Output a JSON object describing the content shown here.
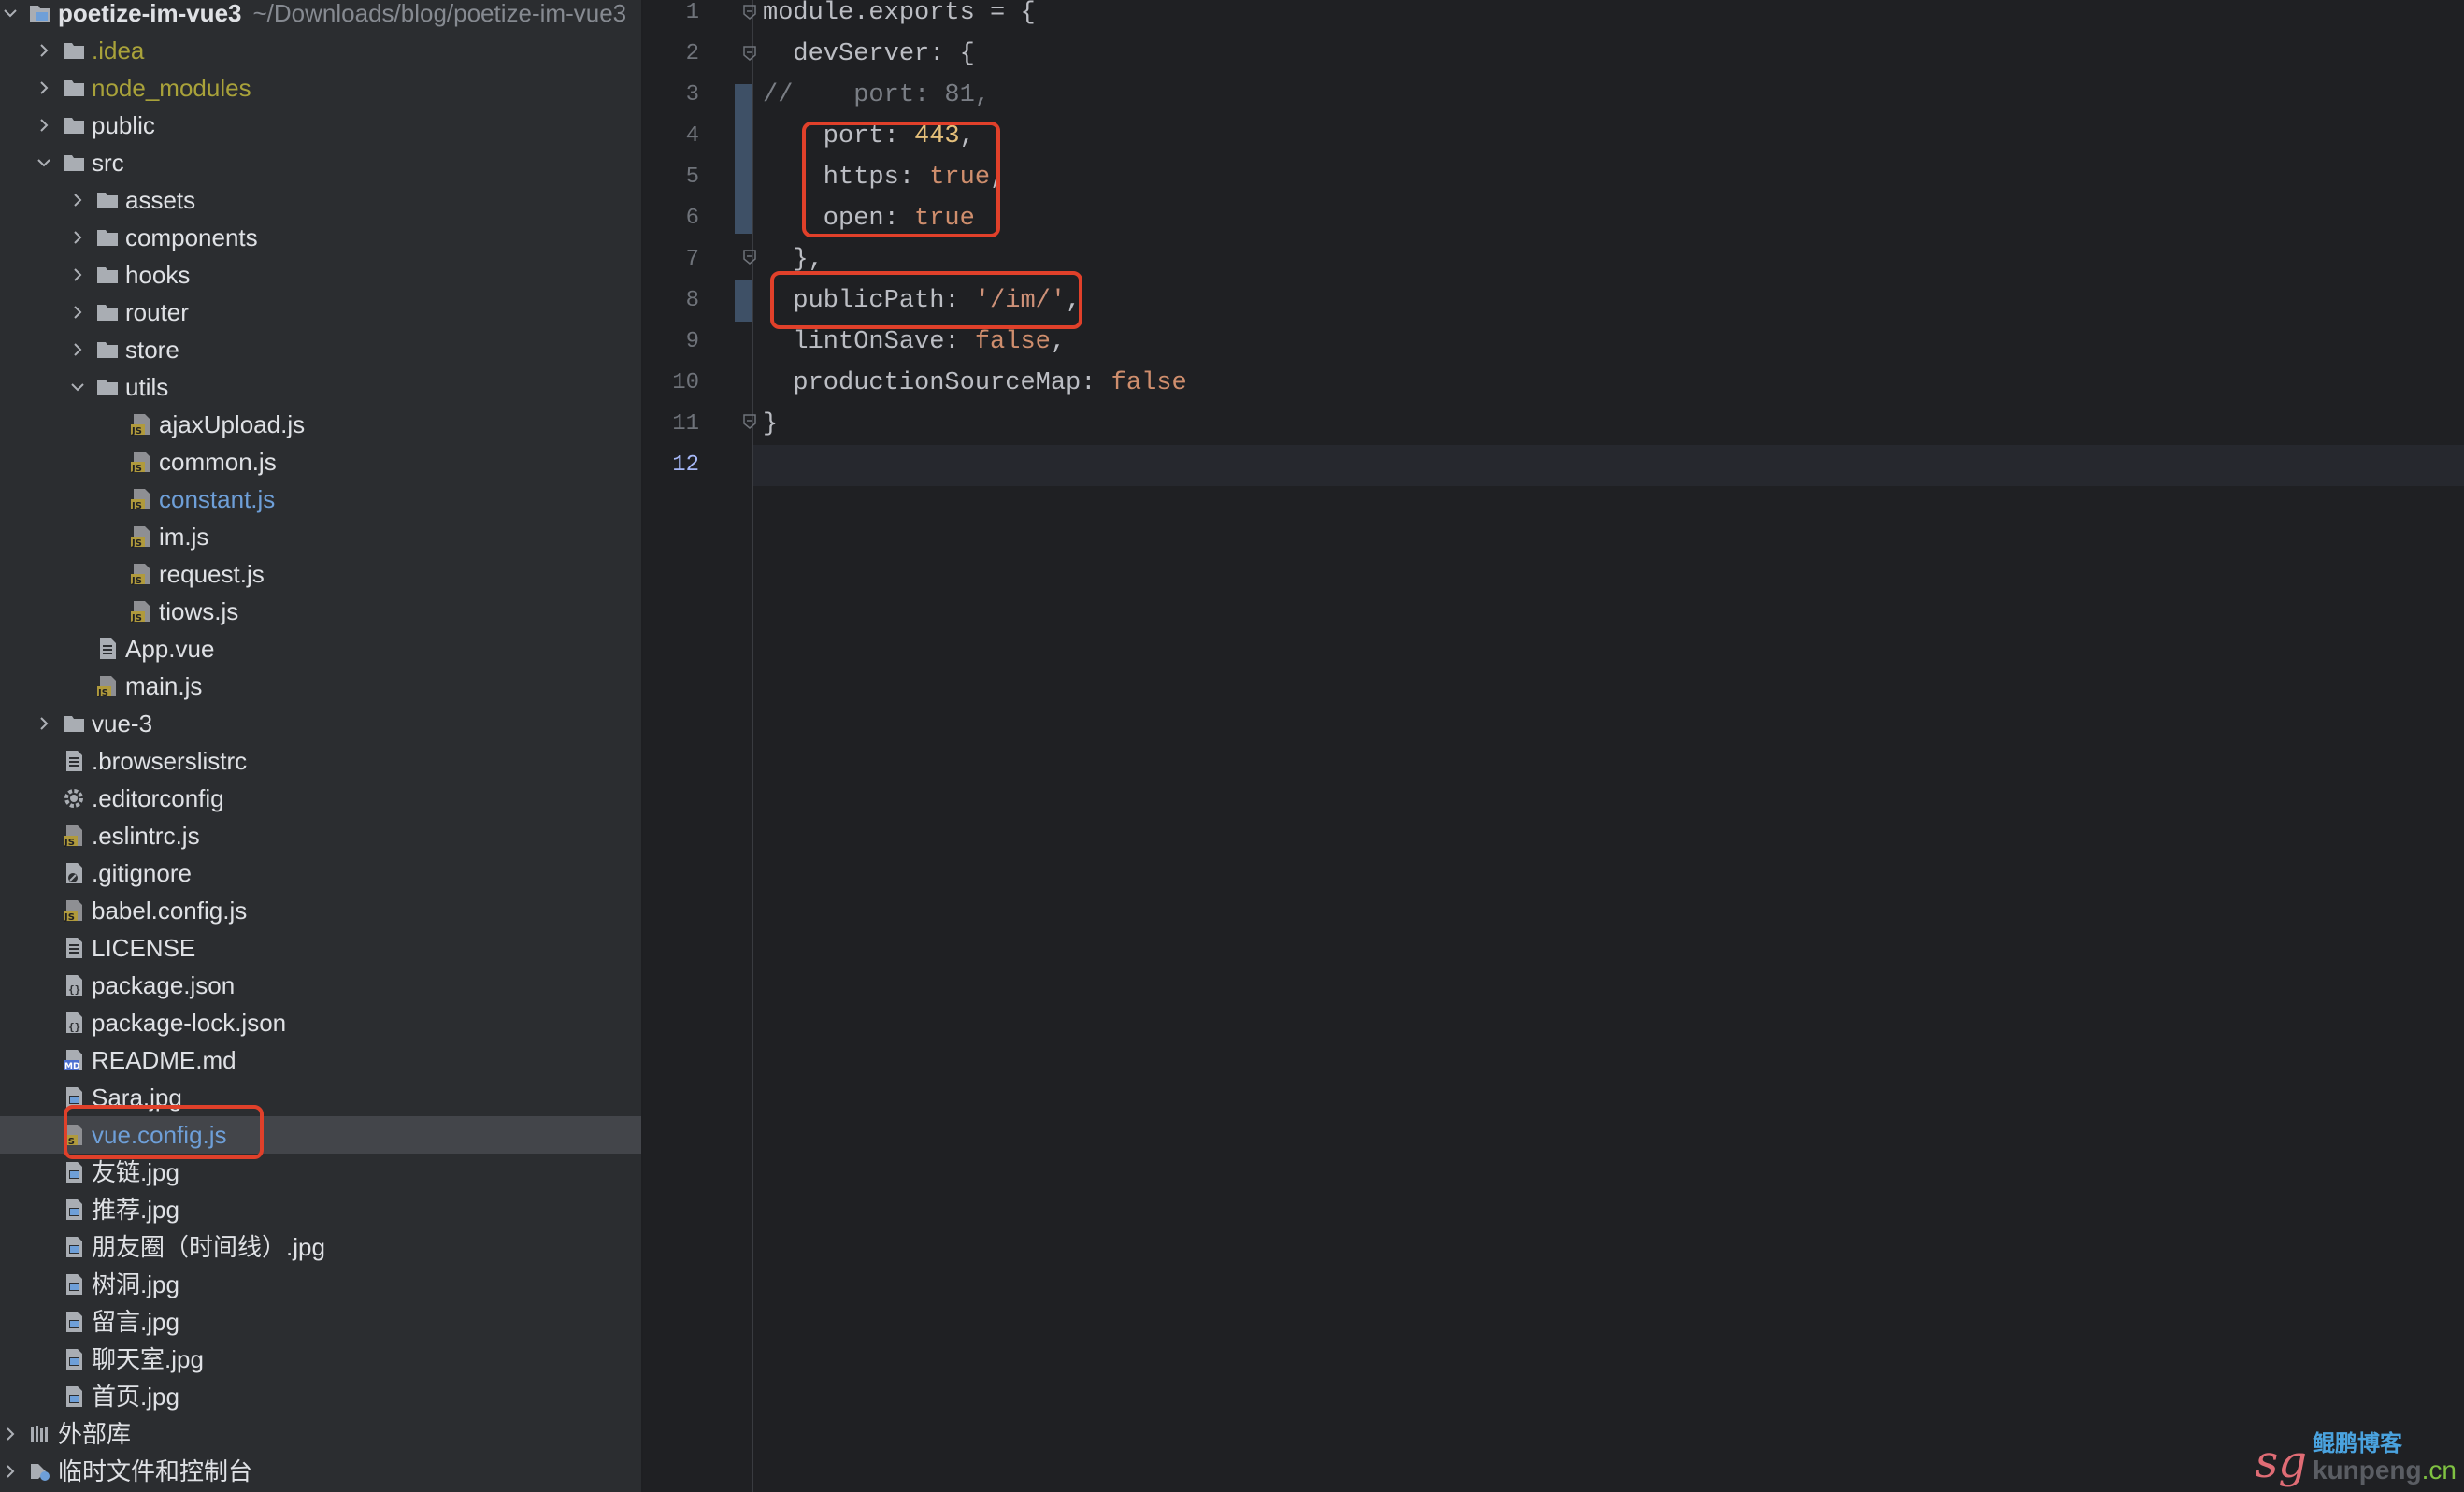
{
  "project_tree": {
    "root": {
      "name": "poetize-im-vue3",
      "path": "~/Downloads/blog/poetize-im-vue3"
    },
    "items": [
      {
        "label": "poetize-im-vue3",
        "type": "project",
        "depth": 0,
        "expanded": true
      },
      {
        "label": ".idea",
        "type": "folder",
        "depth": 1,
        "expanded": false,
        "color": "olive"
      },
      {
        "label": "node_modules",
        "type": "folder",
        "depth": 1,
        "expanded": false,
        "color": "olive"
      },
      {
        "label": "public",
        "type": "folder",
        "depth": 1,
        "expanded": false
      },
      {
        "label": "src",
        "type": "folder",
        "depth": 1,
        "expanded": true
      },
      {
        "label": "assets",
        "type": "folder",
        "depth": 2,
        "expanded": false
      },
      {
        "label": "components",
        "type": "folder",
        "depth": 2,
        "expanded": false
      },
      {
        "label": "hooks",
        "type": "folder",
        "depth": 2,
        "expanded": false
      },
      {
        "label": "router",
        "type": "folder",
        "depth": 2,
        "expanded": false
      },
      {
        "label": "store",
        "type": "folder",
        "depth": 2,
        "expanded": false
      },
      {
        "label": "utils",
        "type": "folder",
        "depth": 2,
        "expanded": true
      },
      {
        "label": "ajaxUpload.js",
        "type": "js",
        "depth": 3
      },
      {
        "label": "common.js",
        "type": "js",
        "depth": 3
      },
      {
        "label": "constant.js",
        "type": "js",
        "depth": 3,
        "color": "blue"
      },
      {
        "label": "im.js",
        "type": "js",
        "depth": 3
      },
      {
        "label": "request.js",
        "type": "js",
        "depth": 3
      },
      {
        "label": "tiows.js",
        "type": "js",
        "depth": 3
      },
      {
        "label": "App.vue",
        "type": "doc",
        "depth": 2
      },
      {
        "label": "main.js",
        "type": "js",
        "depth": 2
      },
      {
        "label": "vue-3",
        "type": "folder",
        "depth": 1,
        "expanded": false
      },
      {
        "label": ".browserslistrc",
        "type": "doc",
        "depth": 1
      },
      {
        "label": ".editorconfig",
        "type": "gear",
        "depth": 1
      },
      {
        "label": ".eslintrc.js",
        "type": "js",
        "depth": 1
      },
      {
        "label": ".gitignore",
        "type": "ignore",
        "depth": 1
      },
      {
        "label": "babel.config.js",
        "type": "js",
        "depth": 1
      },
      {
        "label": "LICENSE",
        "type": "doc",
        "depth": 1
      },
      {
        "label": "package.json",
        "type": "json",
        "depth": 1
      },
      {
        "label": "package-lock.json",
        "type": "json",
        "depth": 1
      },
      {
        "label": "README.md",
        "type": "md",
        "depth": 1
      },
      {
        "label": "Sara.jpg",
        "type": "image",
        "depth": 1
      },
      {
        "label": "vue.config.js",
        "type": "js",
        "depth": 1,
        "color": "blue",
        "selected": true
      },
      {
        "label": "友链.jpg",
        "type": "image",
        "depth": 1
      },
      {
        "label": "推荐.jpg",
        "type": "image",
        "depth": 1
      },
      {
        "label": "朋友圈（时间线）.jpg",
        "type": "image",
        "depth": 1
      },
      {
        "label": "树洞.jpg",
        "type": "image",
        "depth": 1
      },
      {
        "label": "留言.jpg",
        "type": "image",
        "depth": 1
      },
      {
        "label": "聊天室.jpg",
        "type": "image",
        "depth": 1
      },
      {
        "label": "首页.jpg",
        "type": "image",
        "depth": 1
      },
      {
        "label": "外部库",
        "type": "library",
        "depth": 0,
        "expanded": false
      },
      {
        "label": "临时文件和控制台",
        "type": "scratch",
        "depth": 0,
        "expanded": false
      }
    ]
  },
  "editor": {
    "file": "vue.config.js",
    "current_line": 12,
    "lines": [
      {
        "n": "1",
        "tokens": [
          [
            "plain",
            "module.exports = {"
          ]
        ]
      },
      {
        "n": "2",
        "tokens": [
          [
            "plain",
            "  devServer: {"
          ]
        ]
      },
      {
        "n": "3",
        "tokens": [
          [
            "cmt",
            "//    port: 81,"
          ]
        ]
      },
      {
        "n": "4",
        "tokens": [
          [
            "plain",
            "    port: "
          ],
          [
            "num",
            "443"
          ],
          [
            "plain",
            ","
          ]
        ]
      },
      {
        "n": "5",
        "tokens": [
          [
            "plain",
            "    https: "
          ],
          [
            "kw",
            "true"
          ],
          [
            "plain",
            ","
          ]
        ]
      },
      {
        "n": "6",
        "tokens": [
          [
            "plain",
            "    open: "
          ],
          [
            "kw",
            "true"
          ]
        ]
      },
      {
        "n": "7",
        "tokens": [
          [
            "plain",
            "  },"
          ]
        ]
      },
      {
        "n": "8",
        "tokens": [
          [
            "plain",
            "  publicPath: "
          ],
          [
            "strq",
            "'/im/'"
          ],
          [
            "plain",
            ","
          ]
        ]
      },
      {
        "n": "9",
        "tokens": [
          [
            "plain",
            "  lintOnSave: "
          ],
          [
            "kw",
            "false"
          ],
          [
            "plain",
            ","
          ]
        ]
      },
      {
        "n": "10",
        "tokens": [
          [
            "plain",
            "  productionSourceMap: "
          ],
          [
            "kw",
            "false"
          ]
        ]
      },
      {
        "n": "11",
        "tokens": [
          [
            "plain",
            "}"
          ]
        ]
      },
      {
        "n": "12",
        "tokens": []
      }
    ]
  },
  "watermark": {
    "logo": "sg",
    "name_cn": "鲲鹏博客",
    "domain": "kunpeng",
    "tld": ".cn"
  },
  "colors": {
    "sidebar_bg": "#2b2d30",
    "editor_bg": "#1f2023",
    "highlight_box": "#e0402a",
    "selection": "#43454a",
    "keyword": "#cf8e6d"
  }
}
